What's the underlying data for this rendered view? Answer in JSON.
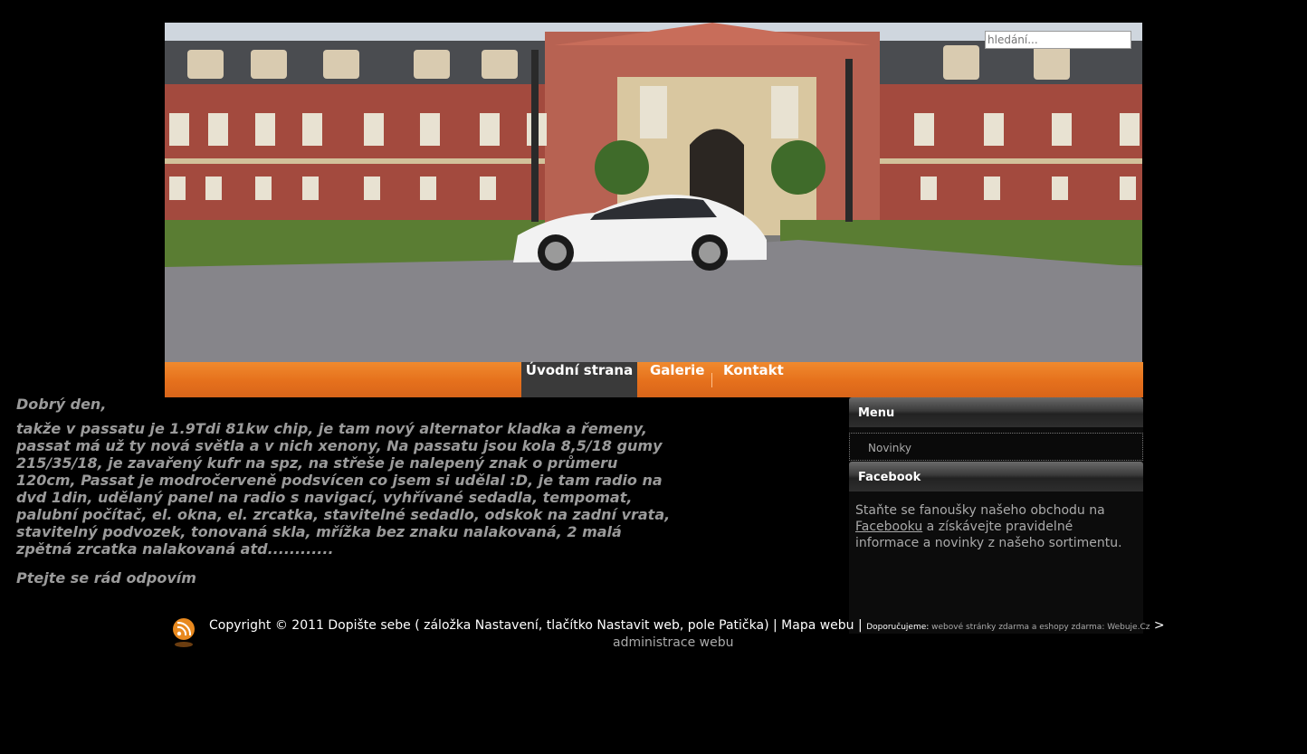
{
  "search": {
    "placeholder": "hledání..."
  },
  "nav": {
    "tabs": [
      {
        "label": "Úvodní strana",
        "active": true
      },
      {
        "label": "Galerie",
        "active": false
      },
      {
        "label": "Kontakt",
        "active": false
      }
    ]
  },
  "content": {
    "greeting": "Dobrý den,",
    "body": "takže v passatu je 1.9Tdi 81kw chip, je tam nový alternator kladka a řemeny, passat má už ty nová světla a v nich xenony, Na passatu jsou kola 8,5/18 gumy 215/35/18, je zavařený kufr na spz, na střeše je nalepený znak o průmeru 120cm, Passat je modročerveně podsvícen co jsem si udělal :D, je tam radio na dvd 1din, udělaný panel na radio s navigací, vyhřívané sedadla, tempomat, palubní počítač, el. okna, el. zrcatka, stavitelné sedadlo, odskok na zadní vrata, stavitelný podvozek, tonovaná skla, mřížka bez znaku nalakovaná, 2 malá zpětná zrcatka nalakovaná atd............",
    "closing": "Ptejte se rád odpovím"
  },
  "sidebar": {
    "menu_title": "Menu",
    "menu_items": [
      "Novinky"
    ],
    "facebook_title": "Facebook",
    "facebook_text_before": "Staňte se fanoušky našeho obchodu na ",
    "facebook_link": "Facebooku",
    "facebook_text_after": " a získávejte pravidelné informace a novinky z našeho sortimentu."
  },
  "footer": {
    "copyright": "Copyright © 2011 Dopište sebe ( záložka Nastavení, tlačítko Nastavit web, pole Patička) | ",
    "sitemap": "Mapa webu",
    "divider": " | ",
    "recommend_label": "Doporučujeme: ",
    "recommend_text": "webové stránky zdarma a eshopy zdarma: ",
    "recommend_link": "Webuje.Cz",
    "arrow": " >",
    "admin": "administrace webu"
  },
  "colors": {
    "nav_orange": "#e5701c",
    "nav_active": "#3a3a3a",
    "background": "#000000"
  }
}
